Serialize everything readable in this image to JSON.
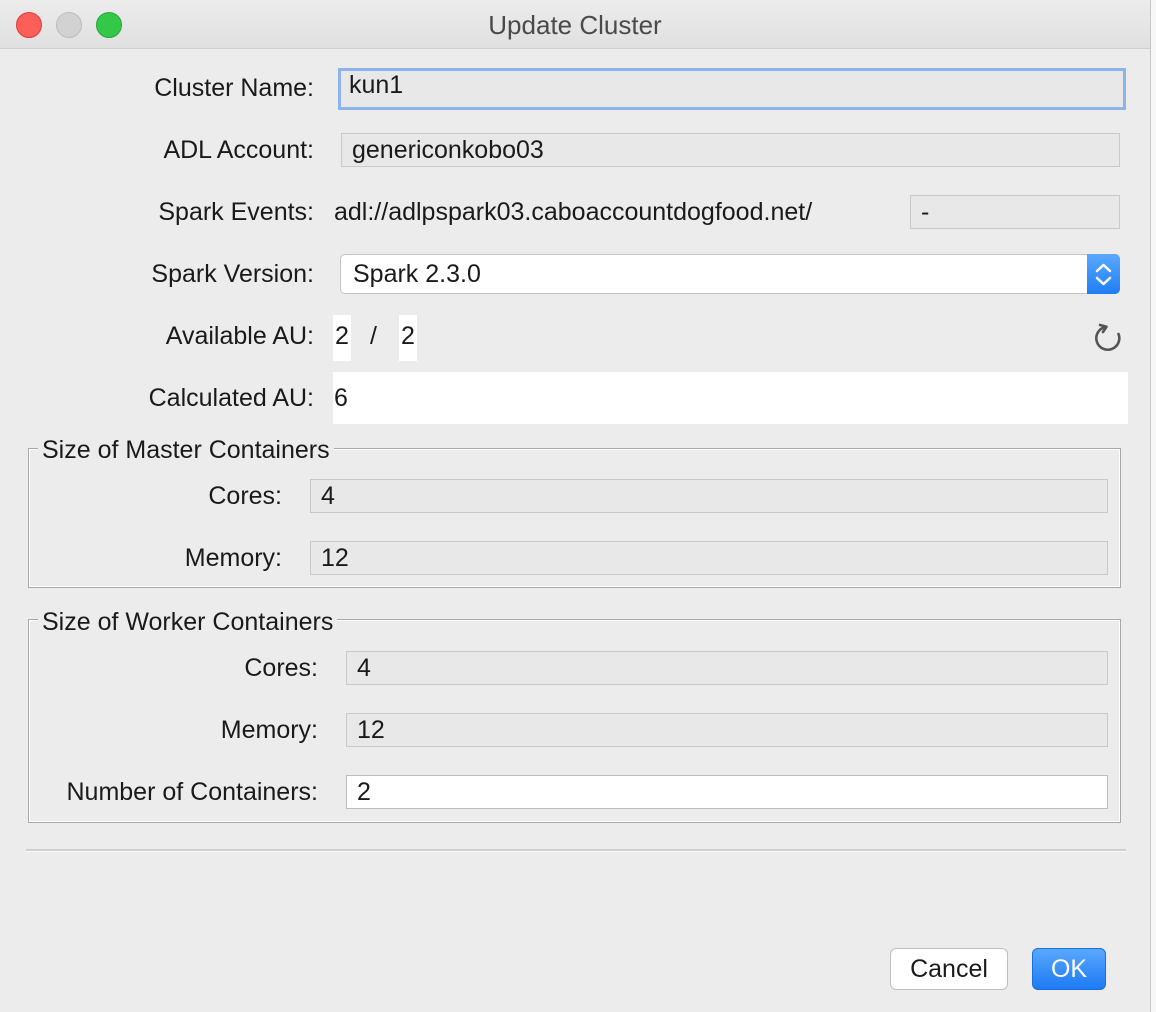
{
  "window": {
    "title": "Update Cluster"
  },
  "fields": {
    "cluster_name": {
      "label": "Cluster Name:",
      "value": "kun1"
    },
    "adl_account": {
      "label": "ADL Account:",
      "value": "genericonkobo03"
    },
    "spark_events": {
      "label": "Spark Events:",
      "prefix": "adl://adlpspark03.caboaccountdogfood.net/",
      "value": "-"
    },
    "spark_version": {
      "label": "Spark Version:",
      "selected": "Spark 2.3.0"
    },
    "available_au": {
      "label": "Available AU:",
      "available": "2",
      "separator": "/",
      "total": "2"
    },
    "calculated_au": {
      "label": "Calculated AU:",
      "value": "6"
    }
  },
  "master": {
    "title": "Size of Master Containers",
    "cores": {
      "label": "Cores:",
      "value": "4"
    },
    "memory": {
      "label": "Memory:",
      "value": "12"
    }
  },
  "worker": {
    "title": "Size of Worker Containers",
    "cores": {
      "label": "Cores:",
      "value": "4"
    },
    "memory": {
      "label": "Memory:",
      "value": "12"
    },
    "count": {
      "label": "Number of Containers:",
      "value": "2"
    }
  },
  "buttons": {
    "cancel": "Cancel",
    "ok": "OK"
  },
  "colors": {
    "accent": "#1d7bf3",
    "focus_ring": "#8bb4ea",
    "close": "#fc5f57",
    "maximize": "#34c748"
  },
  "icons": {
    "refresh": "refresh-icon",
    "stepper": "chevron-up-down-icon"
  }
}
